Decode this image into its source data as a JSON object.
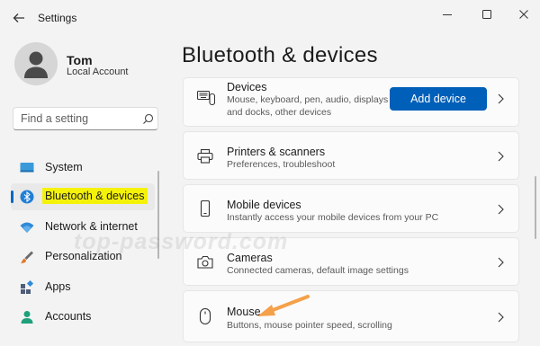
{
  "app": {
    "title": "Settings"
  },
  "user": {
    "name": "Tom",
    "account_type": "Local Account"
  },
  "search": {
    "placeholder": "Find a setting"
  },
  "sidebar": {
    "items": [
      {
        "label": "System",
        "icon": "system-icon",
        "active": false
      },
      {
        "label": "Bluetooth & devices",
        "icon": "bluetooth-icon",
        "active": true
      },
      {
        "label": "Network & internet",
        "icon": "wifi-icon",
        "active": false
      },
      {
        "label": "Personalization",
        "icon": "brush-icon",
        "active": false
      },
      {
        "label": "Apps",
        "icon": "apps-icon",
        "active": false
      },
      {
        "label": "Accounts",
        "icon": "accounts-icon",
        "active": false
      }
    ]
  },
  "main": {
    "title": "Bluetooth & devices",
    "cards": [
      {
        "title": "Devices",
        "subtitle": "Mouse, keyboard, pen, audio, displays and docks, other devices",
        "icon": "devices-icon",
        "button": "Add device"
      },
      {
        "title": "Printers & scanners",
        "subtitle": "Preferences, troubleshoot",
        "icon": "printer-icon"
      },
      {
        "title": "Mobile devices",
        "subtitle": "Instantly access your mobile devices from your PC",
        "icon": "phone-icon"
      },
      {
        "title": "Cameras",
        "subtitle": "Connected cameras, default image settings",
        "icon": "camera-icon"
      },
      {
        "title": "Mouse",
        "subtitle": "Buttons, mouse pointer speed, scrolling",
        "icon": "mouse-icon"
      }
    ]
  },
  "watermark": "top-password.com",
  "colors": {
    "accent": "#005fb8",
    "highlight": "#f5f20a",
    "arrow": "#f4a14a"
  }
}
